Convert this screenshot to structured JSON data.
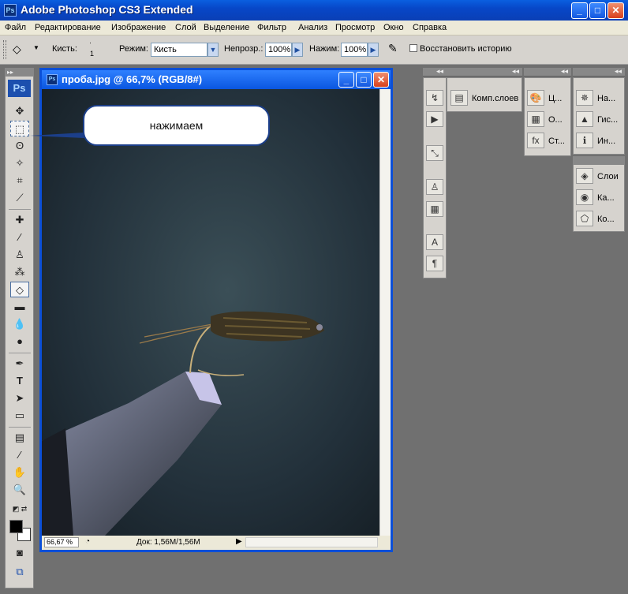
{
  "app": {
    "title": "Adobe Photoshop CS3 Extended",
    "logo": "Ps"
  },
  "window_controls": {
    "minimize": "_",
    "maximize": "□",
    "close": "✕"
  },
  "menu": [
    "Файл",
    "Редактирование",
    "Изображение",
    "Слой",
    "Выделение",
    "Фильтр",
    "Анализ",
    "Просмотр",
    "Окно",
    "Справка"
  ],
  "options": {
    "brush_label": "Кисть:",
    "brush_size": "1",
    "mode_label": "Режим:",
    "mode_value": "Кисть",
    "opacity_label": "Непрозр.:",
    "opacity_value": "100%",
    "flow_label": "Нажим:",
    "flow_value": "100%",
    "history_label": "Восстановить историю"
  },
  "document": {
    "title": "проба.jpg @ 66,7% (RGB/8#)",
    "zoom": "66,67 %",
    "doc_info": "Док: 1,56M/1,56M"
  },
  "callout": {
    "text": "нажимаем"
  },
  "panels": {
    "col1": [
      "history-icon",
      "actions-icon",
      "tool-presets-icon",
      "clone-source-icon",
      "brushes-icon",
      "character-icon",
      "paragraph-icon"
    ],
    "comps": "Комп.слоев",
    "color": [
      "Ц...",
      "О...",
      "Ст..."
    ],
    "nav": [
      "На...",
      "Гис...",
      "Ин..."
    ],
    "layers": [
      "Слои",
      "Ка...",
      "Ко..."
    ]
  },
  "colors": {
    "titlebar": "#0a56e0",
    "panel": "#d6d3ce",
    "workspace": "#707070"
  }
}
